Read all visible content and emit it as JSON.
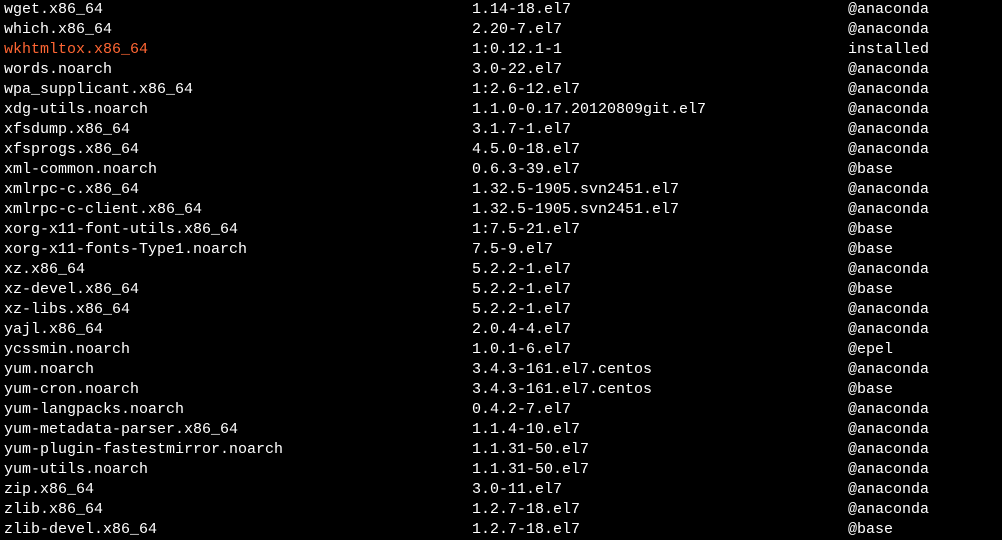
{
  "packages": [
    {
      "name": "wget.x86_64",
      "version": "1.14-18.el7",
      "repo": "@anaconda",
      "highlighted": false
    },
    {
      "name": "which.x86_64",
      "version": "2.20-7.el7",
      "repo": "@anaconda",
      "highlighted": false
    },
    {
      "name": "wkhtmltox.x86_64",
      "version": "1:0.12.1-1",
      "repo": "installed",
      "highlighted": true
    },
    {
      "name": "words.noarch",
      "version": "3.0-22.el7",
      "repo": "@anaconda",
      "highlighted": false
    },
    {
      "name": "wpa_supplicant.x86_64",
      "version": "1:2.6-12.el7",
      "repo": "@anaconda",
      "highlighted": false
    },
    {
      "name": "xdg-utils.noarch",
      "version": "1.1.0-0.17.20120809git.el7",
      "repo": "@anaconda",
      "highlighted": false
    },
    {
      "name": "xfsdump.x86_64",
      "version": "3.1.7-1.el7",
      "repo": "@anaconda",
      "highlighted": false
    },
    {
      "name": "xfsprogs.x86_64",
      "version": "4.5.0-18.el7",
      "repo": "@anaconda",
      "highlighted": false
    },
    {
      "name": "xml-common.noarch",
      "version": "0.6.3-39.el7",
      "repo": "@base",
      "highlighted": false
    },
    {
      "name": "xmlrpc-c.x86_64",
      "version": "1.32.5-1905.svn2451.el7",
      "repo": "@anaconda",
      "highlighted": false
    },
    {
      "name": "xmlrpc-c-client.x86_64",
      "version": "1.32.5-1905.svn2451.el7",
      "repo": "@anaconda",
      "highlighted": false
    },
    {
      "name": "xorg-x11-font-utils.x86_64",
      "version": "1:7.5-21.el7",
      "repo": "@base",
      "highlighted": false
    },
    {
      "name": "xorg-x11-fonts-Type1.noarch",
      "version": "7.5-9.el7",
      "repo": "@base",
      "highlighted": false
    },
    {
      "name": "xz.x86_64",
      "version": "5.2.2-1.el7",
      "repo": "@anaconda",
      "highlighted": false
    },
    {
      "name": "xz-devel.x86_64",
      "version": "5.2.2-1.el7",
      "repo": "@base",
      "highlighted": false
    },
    {
      "name": "xz-libs.x86_64",
      "version": "5.2.2-1.el7",
      "repo": "@anaconda",
      "highlighted": false
    },
    {
      "name": "yajl.x86_64",
      "version": "2.0.4-4.el7",
      "repo": "@anaconda",
      "highlighted": false
    },
    {
      "name": "ycssmin.noarch",
      "version": "1.0.1-6.el7",
      "repo": "@epel",
      "highlighted": false
    },
    {
      "name": "yum.noarch",
      "version": "3.4.3-161.el7.centos",
      "repo": "@anaconda",
      "highlighted": false
    },
    {
      "name": "yum-cron.noarch",
      "version": "3.4.3-161.el7.centos",
      "repo": "@base",
      "highlighted": false
    },
    {
      "name": "yum-langpacks.noarch",
      "version": "0.4.2-7.el7",
      "repo": "@anaconda",
      "highlighted": false
    },
    {
      "name": "yum-metadata-parser.x86_64",
      "version": "1.1.4-10.el7",
      "repo": "@anaconda",
      "highlighted": false
    },
    {
      "name": "yum-plugin-fastestmirror.noarch",
      "version": "1.1.31-50.el7",
      "repo": "@anaconda",
      "highlighted": false
    },
    {
      "name": "yum-utils.noarch",
      "version": "1.1.31-50.el7",
      "repo": "@anaconda",
      "highlighted": false
    },
    {
      "name": "zip.x86_64",
      "version": "3.0-11.el7",
      "repo": "@anaconda",
      "highlighted": false
    },
    {
      "name": "zlib.x86_64",
      "version": "1.2.7-18.el7",
      "repo": "@anaconda",
      "highlighted": false
    },
    {
      "name": "zlib-devel.x86_64",
      "version": "1.2.7-18.el7",
      "repo": "@base",
      "highlighted": false
    }
  ]
}
